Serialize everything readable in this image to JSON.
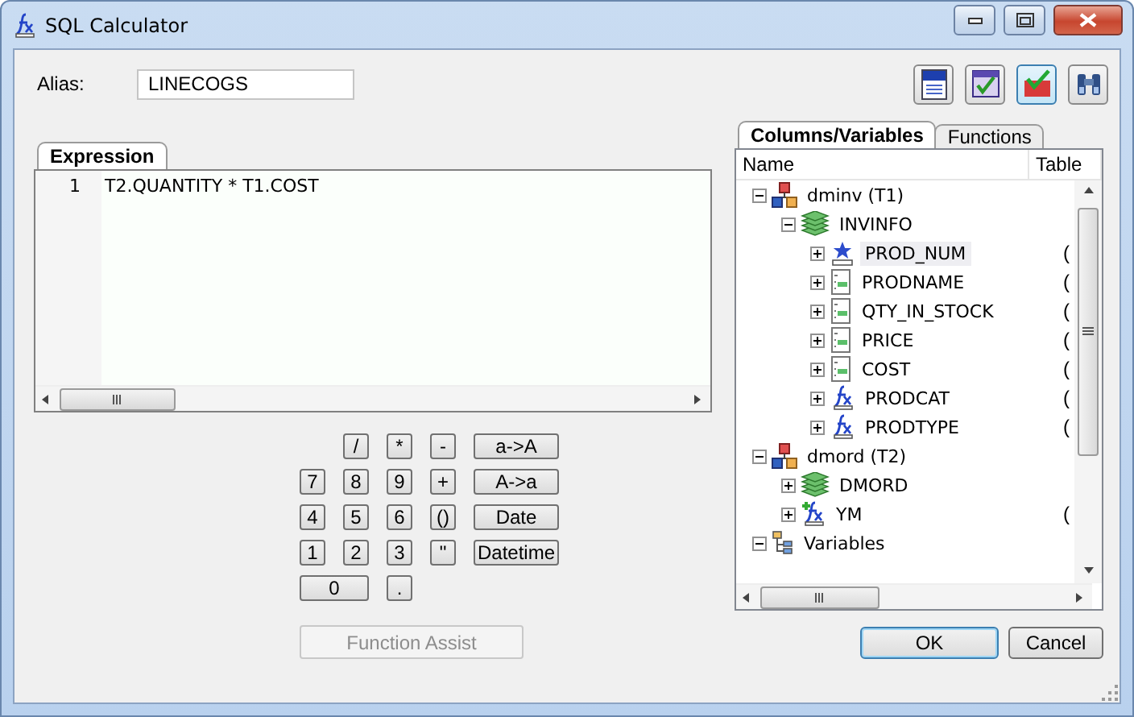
{
  "window": {
    "title": "SQL Calculator"
  },
  "alias": {
    "label": "Alias:",
    "value": "LINECOGS"
  },
  "toolbar": [
    {
      "kind": "sql-doc",
      "selected": false
    },
    {
      "kind": "check-grid",
      "selected": false
    },
    {
      "kind": "sql-check",
      "selected": true
    },
    {
      "kind": "binoculars",
      "selected": false
    }
  ],
  "expression": {
    "tab": "Expression",
    "lines": [
      {
        "number": "1",
        "text": "T2.QUANTITY * T1.COST"
      }
    ]
  },
  "keypad": [
    {
      "keys": [
        {
          "label": "/",
          "kind": "narrow"
        },
        {
          "label": "*",
          "kind": "narrow"
        },
        {
          "label": "-",
          "kind": "narrow"
        },
        {
          "label": "a->A",
          "kind": "wide"
        }
      ]
    },
    {
      "keys": [
        {
          "label": "7",
          "kind": "narrow"
        },
        {
          "label": "8",
          "kind": "narrow"
        },
        {
          "label": "9",
          "kind": "narrow"
        },
        {
          "label": "+",
          "kind": "narrow"
        },
        {
          "label": "A->a",
          "kind": "wide"
        }
      ]
    },
    {
      "keys": [
        {
          "label": "4",
          "kind": "narrow"
        },
        {
          "label": "5",
          "kind": "narrow"
        },
        {
          "label": "6",
          "kind": "narrow"
        },
        {
          "label": "()",
          "kind": "narrow"
        },
        {
          "label": "Date",
          "kind": "wide"
        }
      ]
    },
    {
      "keys": [
        {
          "label": "1",
          "kind": "narrow"
        },
        {
          "label": "2",
          "kind": "narrow"
        },
        {
          "label": "3",
          "kind": "narrow"
        },
        {
          "label": "''",
          "kind": "narrow"
        },
        {
          "label": "Datetime",
          "kind": "wide"
        }
      ]
    },
    {
      "keys": [
        {
          "label": "0",
          "kind": "double"
        },
        {
          "label": ".",
          "kind": "narrow"
        }
      ]
    }
  ],
  "function_assist": {
    "label": "Function Assist",
    "disabled": true
  },
  "side_tabs": [
    {
      "label": "Columns/Variables",
      "selected": true
    },
    {
      "label": "Functions",
      "selected": false
    }
  ],
  "tree": {
    "columns": [
      "Name",
      "Table"
    ],
    "items": [
      {
        "name": "dminv (T1)",
        "kind": "database",
        "expanded": true,
        "selected": false,
        "children": [
          {
            "name": "INVINFO",
            "kind": "table",
            "expanded": true,
            "selected": false,
            "children": [
              {
                "name": "PROD_NUM",
                "kind": "key-column",
                "expanded": false,
                "selected": true,
                "table": "("
              },
              {
                "name": "PRODNAME",
                "kind": "column",
                "expanded": false,
                "selected": false,
                "table": "("
              },
              {
                "name": "QTY_IN_STOCK",
                "kind": "column",
                "expanded": false,
                "selected": false,
                "table": "("
              },
              {
                "name": "PRICE",
                "kind": "column",
                "expanded": false,
                "selected": false,
                "table": "("
              },
              {
                "name": "COST",
                "kind": "column",
                "expanded": false,
                "selected": false,
                "table": "("
              },
              {
                "name": "PRODCAT",
                "kind": "computed",
                "expanded": false,
                "selected": false,
                "table": "("
              },
              {
                "name": "PRODTYPE",
                "kind": "computed",
                "expanded": false,
                "selected": false,
                "table": "("
              }
            ]
          }
        ]
      },
      {
        "name": "dmord (T2)",
        "kind": "database",
        "expanded": true,
        "selected": false,
        "children": [
          {
            "name": "DMORD",
            "kind": "table",
            "expanded": false,
            "selected": false
          },
          {
            "name": "YM",
            "kind": "new-computed",
            "expanded": false,
            "selected": false,
            "table": "("
          }
        ]
      },
      {
        "name": "Variables",
        "kind": "variables",
        "expanded": true,
        "selected": false
      }
    ]
  },
  "buttons": [
    {
      "label": "OK",
      "default": true
    },
    {
      "label": "Cancel",
      "default": false
    }
  ]
}
